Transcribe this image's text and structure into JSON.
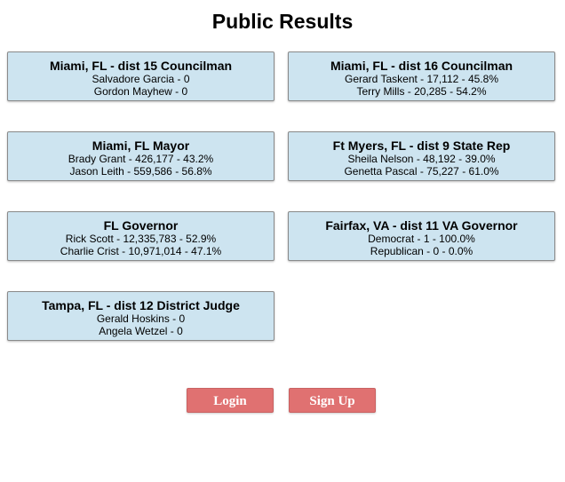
{
  "page_title": "Public Results",
  "races": [
    {
      "title": "Miami, FL - dist 15 Councilman",
      "lines": [
        "Salvadore Garcia - 0",
        "Gordon Mayhew - 0"
      ]
    },
    {
      "title": "Miami, FL - dist 16 Councilman",
      "lines": [
        "Gerard Taskent - 17,112 - 45.8%",
        "Terry Mills - 20,285 - 54.2%"
      ]
    },
    {
      "title": "Miami, FL Mayor",
      "lines": [
        "Brady Grant - 426,177 - 43.2%",
        "Jason Leith - 559,586 - 56.8%"
      ]
    },
    {
      "title": "Ft Myers, FL - dist 9 State Rep",
      "lines": [
        "Sheila Nelson - 48,192 - 39.0%",
        "Genetta Pascal - 75,227 - 61.0%"
      ]
    },
    {
      "title": "FL Governor",
      "lines": [
        "Rick Scott - 12,335,783 - 52.9%",
        "Charlie Crist - 10,971,014 - 47.1%"
      ]
    },
    {
      "title": "Fairfax, VA - dist 11 VA Governor",
      "lines": [
        "Democrat - 1 - 100.0%",
        "Republican - 0 - 0.0%"
      ]
    },
    {
      "title": "Tampa, FL - dist 12 District Judge",
      "lines": [
        "Gerald Hoskins - 0",
        "Angela Wetzel - 0"
      ]
    }
  ],
  "buttons": {
    "login_label": "Login",
    "signup_label": "Sign Up"
  },
  "colors": {
    "card_background": "#cde4f0",
    "button_background": "#e07171"
  }
}
